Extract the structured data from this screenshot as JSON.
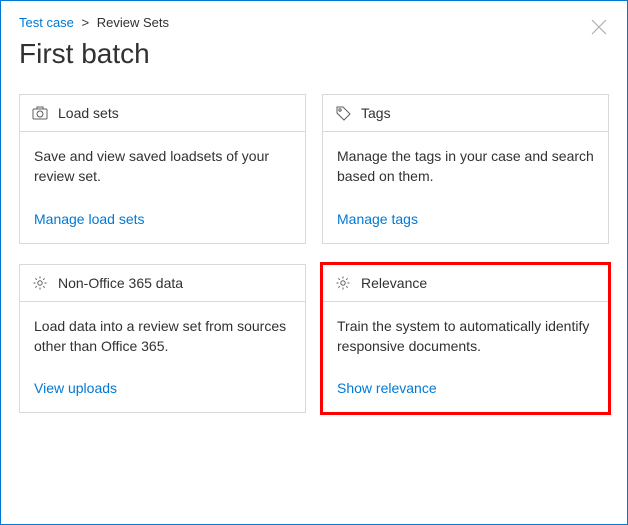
{
  "breadcrumb": {
    "root": "Test case",
    "separator": ">",
    "current": "Review Sets"
  },
  "page_title": "First batch",
  "cards": [
    {
      "icon": "camera-icon",
      "title": "Load sets",
      "description": "Save and view saved loadsets of your review set.",
      "link_label": "Manage load sets",
      "highlighted": false
    },
    {
      "icon": "tag-icon",
      "title": "Tags",
      "description": "Manage the tags in your case and search based on them.",
      "link_label": "Manage tags",
      "highlighted": false
    },
    {
      "icon": "gear-icon",
      "title": "Non-Office 365 data",
      "description": "Load data into a review set from sources other than Office 365.",
      "link_label": "View uploads",
      "highlighted": false
    },
    {
      "icon": "gear-icon",
      "title": "Relevance",
      "description": "Train the system to automatically identify responsive documents.",
      "link_label": "Show relevance",
      "highlighted": true
    }
  ],
  "colors": {
    "accent": "#0078d4",
    "highlight": "#ff0000",
    "border": "#d9d9d9"
  }
}
